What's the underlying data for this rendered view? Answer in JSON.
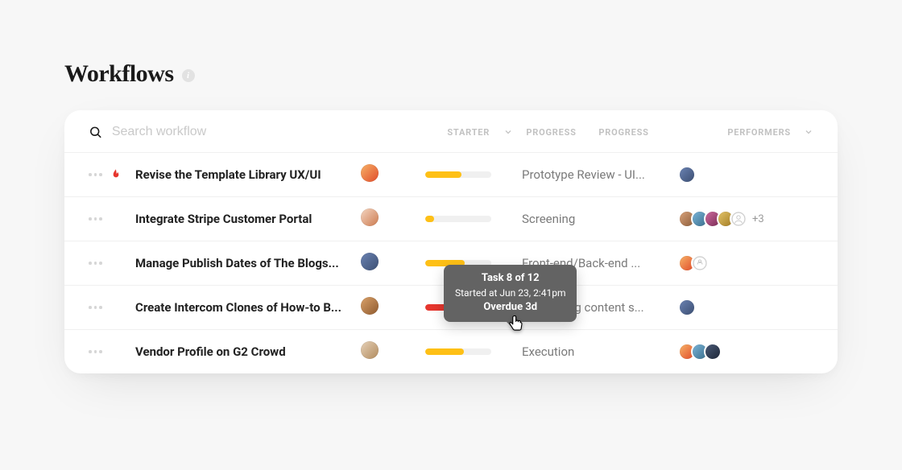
{
  "title": "Workflows",
  "search": {
    "placeholder": "Search workflow"
  },
  "columns": {
    "starter": "STARTER",
    "progress1": "PROGRESS",
    "progress2": "PROGRESS",
    "performers": "PERFORMERS"
  },
  "rows": [
    {
      "urgent": true,
      "title": "Revise the Template Library UX/UI",
      "starter_color": "linear-gradient(135deg,#f7b267,#e04b2a)",
      "progress_pct": 55,
      "progress_color": "p-yellow",
      "stage": "Prototype Review - UI...",
      "performers": [
        {
          "color": "linear-gradient(135deg,#6a82b2,#3c4f73)"
        }
      ],
      "overflow": ""
    },
    {
      "urgent": false,
      "title": "Integrate Stripe Customer Portal",
      "starter_color": "linear-gradient(135deg,#f4d6c2,#cc7a4f)",
      "progress_pct": 14,
      "progress_color": "p-yellow",
      "stage": "Screening",
      "performers": [
        {
          "color": "linear-gradient(135deg,#d8a27a,#8c5c3a)"
        },
        {
          "color": "linear-gradient(135deg,#7ab4d8,#3a6e8c)"
        },
        {
          "color": "linear-gradient(135deg,#ce6b9e,#7a2a55)"
        },
        {
          "color": "linear-gradient(135deg,#e3c46a,#a27b22)"
        },
        {
          "color": "#eee",
          "placeholder": true
        }
      ],
      "overflow": "+3"
    },
    {
      "urgent": false,
      "title": "Manage Publish Dates of The Blogs...",
      "starter_color": "linear-gradient(135deg,#6a82b2,#3c4f73)",
      "progress_pct": 60,
      "progress_color": "p-yellow",
      "stage": "Front-end/Back-end ...",
      "performers": [
        {
          "color": "linear-gradient(135deg,#f7b267,#e04b2a)"
        },
        {
          "color": "#fff",
          "placeholder": true
        }
      ],
      "overflow": ""
    },
    {
      "urgent": false,
      "title": "Create Intercom Clones of How-to B...",
      "starter_color": "linear-gradient(135deg,#d9a16a,#8f5a2e)",
      "progress_pct": 52,
      "progress_color": "p-red",
      "stage": "Developing content s...",
      "performers": [
        {
          "color": "linear-gradient(135deg,#6a82b2,#3c4f73)"
        }
      ],
      "overflow": ""
    },
    {
      "urgent": false,
      "title": "Vendor Profile on G2 Crowd",
      "starter_color": "linear-gradient(135deg,#e6d1b8,#b18b5e)",
      "progress_pct": 58,
      "progress_color": "p-yellow",
      "stage": "Execution",
      "performers": [
        {
          "color": "linear-gradient(135deg,#f7b267,#e04b2a)"
        },
        {
          "color": "linear-gradient(135deg,#7ab4d8,#3a6e8c)"
        },
        {
          "color": "linear-gradient(135deg,#4a5a77,#1e2738)"
        }
      ],
      "overflow": ""
    }
  ],
  "tooltip": {
    "line1": "Task 8 of 12",
    "line2": "Started at Jun 23, 2:41pm",
    "line3": "Overdue 3d"
  }
}
